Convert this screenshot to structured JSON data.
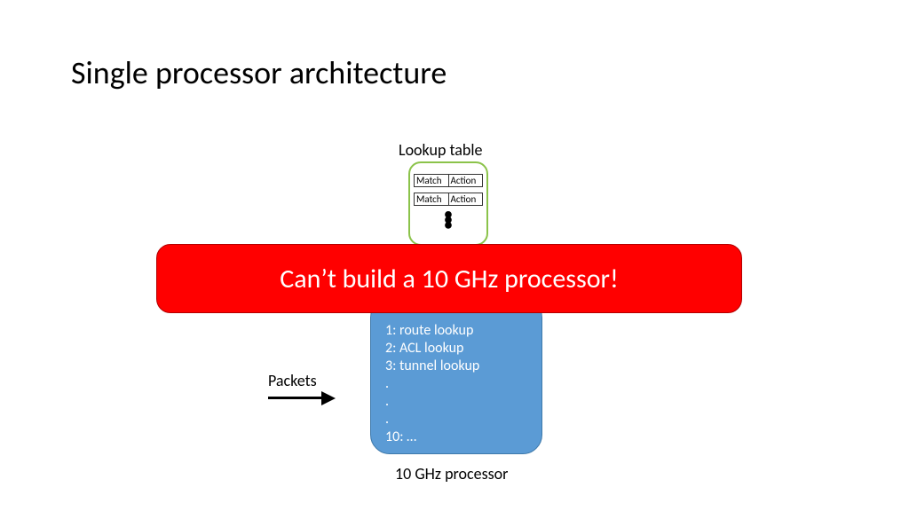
{
  "title": "Single processor architecture",
  "lookup": {
    "label": "Lookup table",
    "row1_match": "Match",
    "row1_action": "Action",
    "row2_match": "Match",
    "row2_action": "Action"
  },
  "processor": {
    "label_bottom": "10 GHz processor",
    "lines": {
      "l1": "1: route lookup",
      "l2": "2: ACL lookup",
      "l3": "3: tunnel lookup",
      "d1": ".",
      "d2": ".",
      "d3": ".",
      "l10": "10: …"
    }
  },
  "packets_label": "Packets",
  "banner_text": "Can’t build a 10 GHz processor!"
}
